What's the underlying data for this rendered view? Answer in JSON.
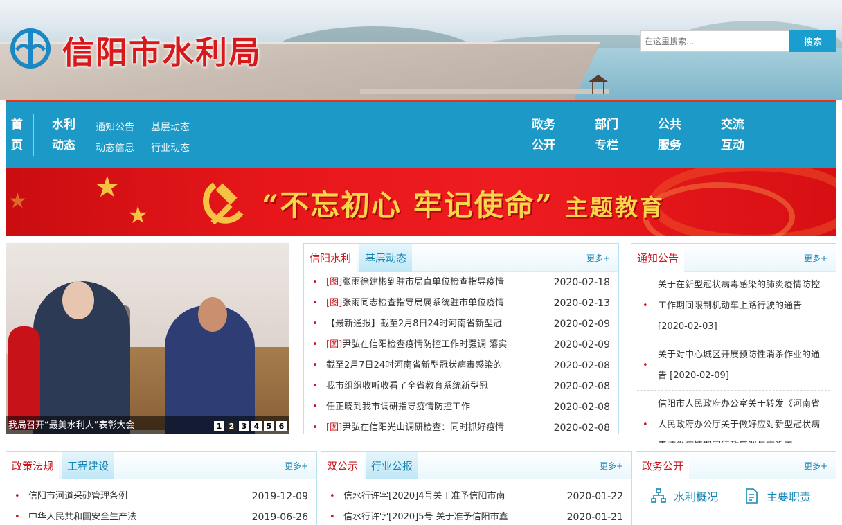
{
  "header": {
    "site_title": "信阳市水利局",
    "search": {
      "placeholder": "在这里搜索...",
      "button_label": "搜索"
    }
  },
  "nav": {
    "home": [
      "首",
      "页"
    ],
    "group1": {
      "title": [
        "水利",
        "动态"
      ],
      "links": [
        "通知公告",
        "基层动态",
        "动态信息",
        "行业动态"
      ]
    },
    "items": [
      {
        "lines": [
          "政务",
          "公开"
        ]
      },
      {
        "lines": [
          "部门",
          "专栏"
        ]
      },
      {
        "lines": [
          "公共",
          "服务"
        ]
      },
      {
        "lines": [
          "交流",
          "互动"
        ]
      }
    ]
  },
  "banner": {
    "main_text": "“不忘初心 牢记使命”",
    "sub_text": "主题教育",
    "colors": {
      "red": "#e5161a",
      "gold": "#f8d54a"
    }
  },
  "slider": {
    "caption": "我局召开“最美水利人”表彰大会",
    "pages": [
      "1",
      "2",
      "3",
      "4",
      "5",
      "6"
    ],
    "active_page": "2"
  },
  "news_panel": {
    "tabs": [
      "信阳水利",
      "基层动态"
    ],
    "more": "更多+",
    "items": [
      {
        "tag": "[图]",
        "title": "张雨徐建彬到驻市局直单位检查指导疫情",
        "date": "2020-02-18"
      },
      {
        "tag": "[图]",
        "title": "张雨同志检查指导局属系统驻市单位疫情",
        "date": "2020-02-13"
      },
      {
        "tag": "",
        "title": "【最新通报】截至2月8日24时河南省新型冠",
        "date": "2020-02-09"
      },
      {
        "tag": "[图]",
        "title": "尹弘在信阳检查疫情防控工作时强调 落实",
        "date": "2020-02-09"
      },
      {
        "tag": "",
        "title": "截至2月7日24时河南省新型冠状病毒感染的",
        "date": "2020-02-08"
      },
      {
        "tag": "",
        "title": "我市组织收听收看了全省教育系统新型冠",
        "date": "2020-02-08"
      },
      {
        "tag": "",
        "title": "任正晓到我市调研指导疫情防控工作",
        "date": "2020-02-08"
      },
      {
        "tag": "[图]",
        "title": "尹弘在信阳光山调研检查：同时抓好疫情",
        "date": "2020-02-08"
      }
    ]
  },
  "notice_panel": {
    "tab": "通知公告",
    "more": "更多+",
    "items": [
      "关于在新型冠状病毒感染的肺炎疫情防控工作期间限制机动车上路行驶的通告 [2020-02-03]",
      "关于对中心城区开展预防性消杀作业的通告 [2020-02-09]",
      "信阳市人民政府办公室关于转发《河南省人民政府办公厅关于做好应对新型冠状病毒肺炎疫情期间行政复议与应诉工"
    ]
  },
  "policy_panel": {
    "tabs": [
      "政策法规",
      "工程建设"
    ],
    "more": "更多+",
    "items": [
      {
        "title": "信阳市河道采砂管理条例",
        "date": "2019-12-09"
      },
      {
        "title": "中华人民共和国安全生产法",
        "date": "2019-06-26"
      }
    ]
  },
  "public_panel": {
    "tabs": [
      "双公示",
      "行业公报"
    ],
    "more": "更多+",
    "items": [
      {
        "title": "信水行许字[2020]4号关于准予信阳市南",
        "date": "2020-01-22"
      },
      {
        "title": "信水行许字[2020]5号 关于准予信阳市鑫",
        "date": "2020-01-21"
      }
    ]
  },
  "gov_panel": {
    "tab": "政务公开",
    "more": "更多+",
    "items": [
      {
        "icon": "org-chart-icon",
        "label": "水利概况"
      },
      {
        "icon": "document-icon",
        "label": "主要职责"
      }
    ]
  }
}
